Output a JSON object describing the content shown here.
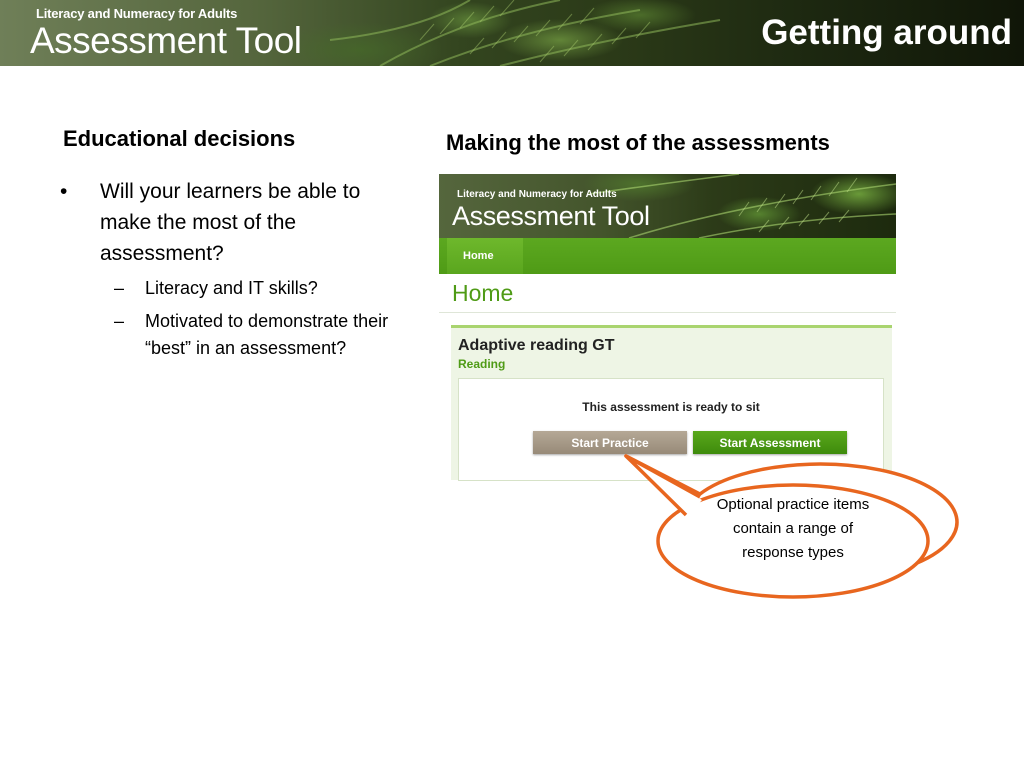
{
  "banner": {
    "brand_small": "Literacy and Numeracy for Adults",
    "brand_big": "Assessment Tool",
    "slide_title": "Getting around"
  },
  "left": {
    "heading": "Educational decisions",
    "bullets": [
      {
        "text": "Will your learners be able to make the most of the assessment?",
        "sub": [
          "Literacy and IT skills?",
          "Motivated to demonstrate their “best” in an assessment?"
        ]
      }
    ]
  },
  "right": {
    "heading": "Making the most of the assessments",
    "screenshot": {
      "brand_small": "Literacy and Numeracy for Adults",
      "brand_big": "Assessment Tool",
      "nav_home": "Home",
      "page_title": "Home",
      "card_title": "Adaptive reading GT",
      "card_subtitle": "Reading",
      "status_text": "This assessment is ready to sit",
      "btn_practice": "Start Practice",
      "btn_assessment": "Start Assessment"
    },
    "callout": "Optional practice items contain a range of response types"
  },
  "colors": {
    "nav_green": "#4f9b16",
    "callout_border": "#e8661f",
    "practice_button": "#a89b88"
  },
  "icons": {
    "bullet": "•",
    "dash": "–"
  }
}
